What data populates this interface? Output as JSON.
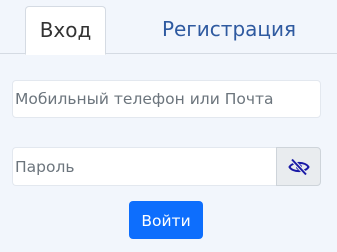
{
  "tabs": {
    "login_label": "Вход",
    "register_label": "Регистрация"
  },
  "form": {
    "login_placeholder": "Мобильный телефон или Почта",
    "login_value": "",
    "password_placeholder": "Пароль",
    "password_value": "",
    "toggle_icon": "eye-slash-icon",
    "submit_label": "Войти"
  },
  "colors": {
    "page_background": "#f2f6fc",
    "active_tab_text": "#333333",
    "inactive_tab_text": "#2f5aa0",
    "primary_button": "#0d6efd",
    "eye_icon": "#1a1aa6"
  }
}
